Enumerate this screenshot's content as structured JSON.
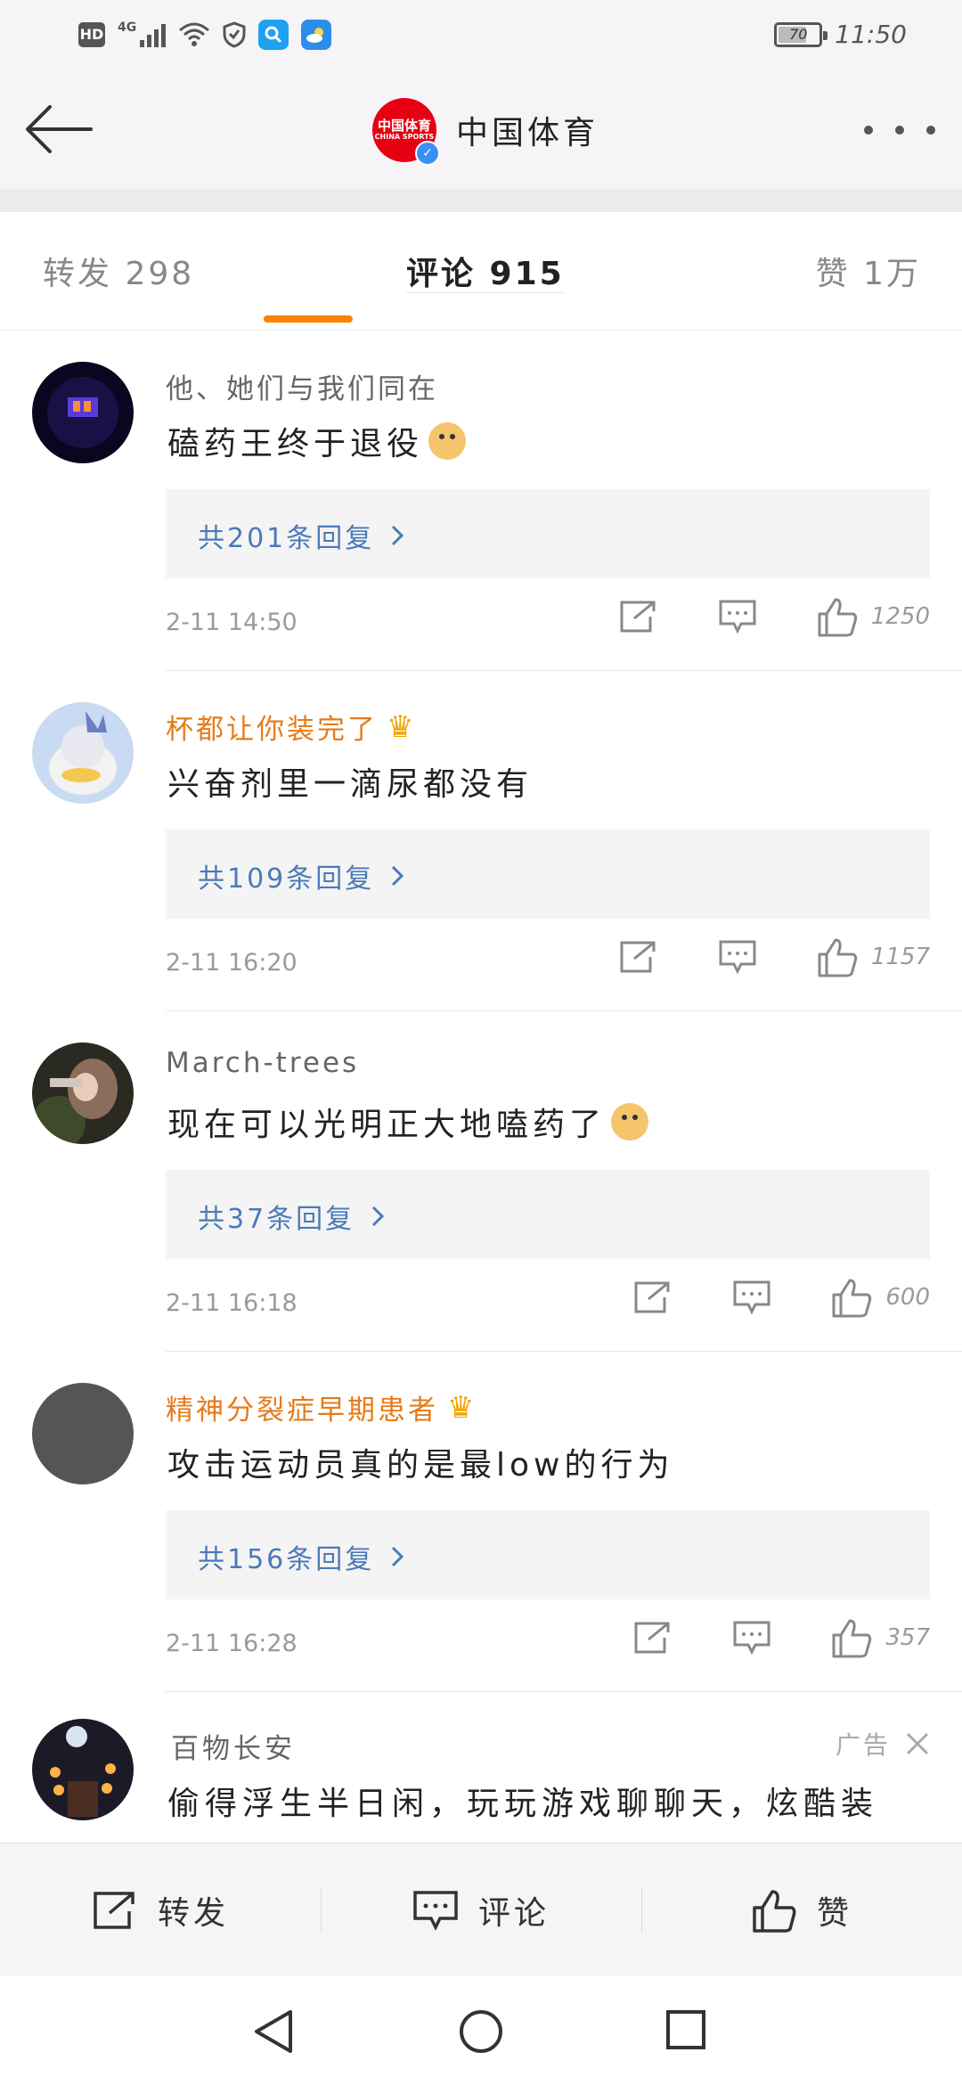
{
  "status_bar": {
    "hd": "HD",
    "network": "4G",
    "battery": "70",
    "battery_level": 0.7,
    "time": "11:50"
  },
  "header": {
    "account_name": "中国体育",
    "logo_text": "中国体育",
    "logo_sub": "CHINA SPORTS"
  },
  "tabs": {
    "repost": "转发 298",
    "comments": "评论 915",
    "likes": "赞 1万"
  },
  "comments": [
    {
      "user": "他、她们与我们同在",
      "vip": false,
      "text": "磕药王终于退役",
      "emoji": true,
      "replies": "共201条回复",
      "date": "2-11 14:50",
      "likes": "1250"
    },
    {
      "user": "杯都让你装完了",
      "vip": true,
      "text": "兴奋剂里一滴尿都没有",
      "emoji": false,
      "replies": "共109条回复",
      "date": "2-11 16:20",
      "likes": "1157"
    },
    {
      "user": "March-trees",
      "vip": false,
      "text": "现在可以光明正大地嗑药了",
      "emoji": true,
      "replies": "共37条回复",
      "date": "2-11 16:18",
      "likes": "600"
    },
    {
      "user": "精神分裂症早期患者",
      "vip": true,
      "text": "攻击运动员真的是最low的行为",
      "emoji": false,
      "replies": "共156条回复",
      "date": "2-11 16:28",
      "likes": "357"
    }
  ],
  "ad": {
    "user": "百物长安",
    "tag": "广告",
    "text": "偷得浮生半日闲，玩玩游戏聊聊天，炫酷装"
  },
  "bottom_bar": {
    "repost": "转发",
    "comment": "评论",
    "like": "赞"
  },
  "colors": {
    "accent": "#ff8200",
    "vip_name": "#e57b1a",
    "reply_link": "#4a7ab8",
    "logo_red": "#e60012"
  }
}
